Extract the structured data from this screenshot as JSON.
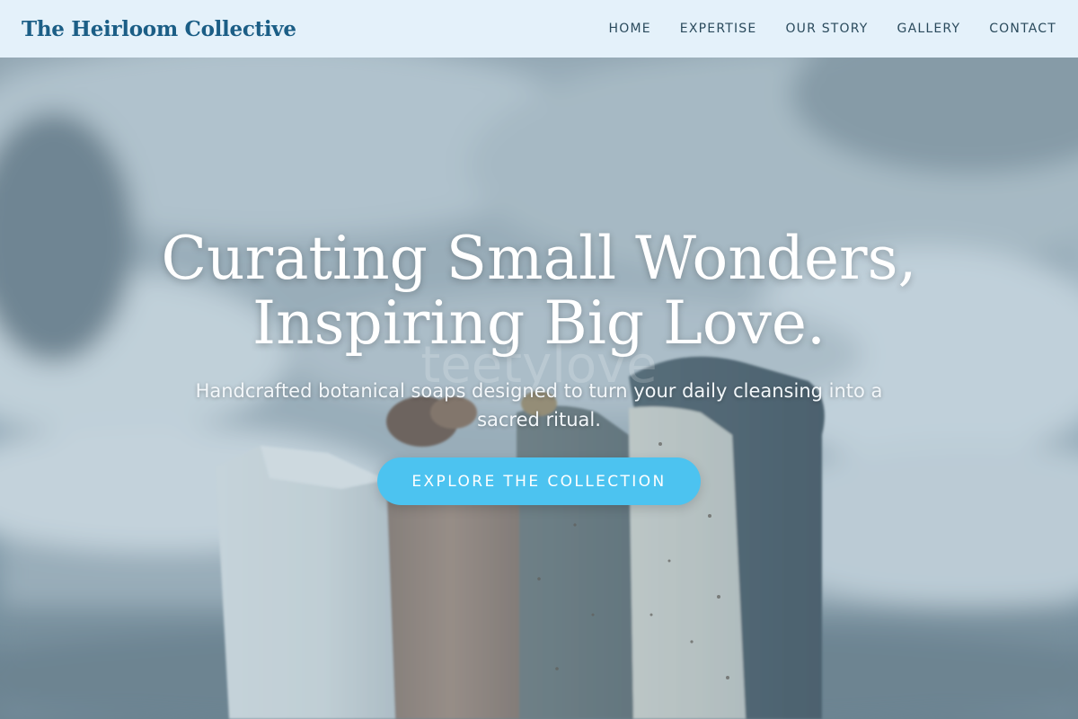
{
  "header": {
    "logo": "The Heirloom Collective",
    "nav": [
      {
        "label": "HOME"
      },
      {
        "label": "EXPERTISE"
      },
      {
        "label": "OUR STORY"
      },
      {
        "label": "GALLERY"
      },
      {
        "label": "CONTACT"
      }
    ]
  },
  "hero": {
    "title_line1": "Curating Small Wonders,",
    "title_line2": "Inspiring Big Love.",
    "subtitle": "Handcrafted botanical soaps designed to turn your daily cleansing into a sacred ritual.",
    "cta_label": "EXPLORE THE COLLECTION",
    "watermark": "teetylove"
  },
  "colors": {
    "header_bg": "#e4f1fa",
    "logo": "#1b5e86",
    "nav_text": "#2a4a5c",
    "cta_bg": "#4cc3f0",
    "hero_text": "#ffffff"
  },
  "icons": [
    "soap-bars-photo"
  ]
}
